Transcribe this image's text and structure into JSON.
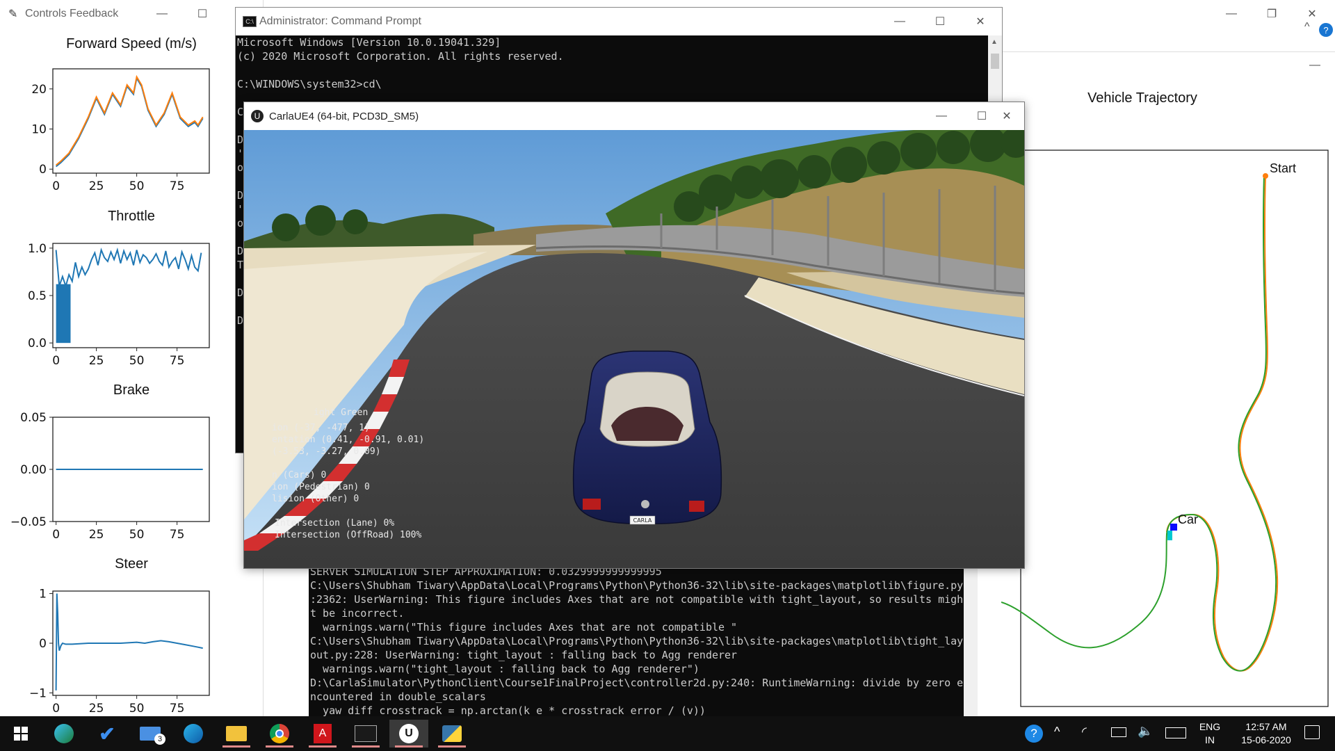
{
  "controls_window": {
    "title": "Controls Feedback",
    "plots": [
      {
        "title": "Forward Speed (m/s)",
        "yticks": [
          "0",
          "10",
          "20"
        ],
        "xticks": [
          "0",
          "25",
          "50",
          "75"
        ]
      },
      {
        "title": "Throttle",
        "yticks": [
          "0.0",
          "0.5",
          "1.0"
        ],
        "xticks": [
          "0",
          "25",
          "50",
          "75"
        ]
      },
      {
        "title": "Brake",
        "yticks": [
          "−0.05",
          "0.00",
          "0.05"
        ],
        "xticks": [
          "0",
          "25",
          "50",
          "75"
        ]
      },
      {
        "title": "Steer",
        "yticks": [
          "−1",
          "0",
          "1"
        ],
        "xticks": [
          "0",
          "25",
          "50",
          "75"
        ]
      }
    ]
  },
  "chart_data": [
    {
      "type": "line",
      "title": "Forward Speed (m/s)",
      "xlim": [
        -2,
        95
      ],
      "ylim": [
        -1,
        25
      ],
      "series": [
        {
          "color": "#ff7f0e",
          "x": [
            0,
            3,
            8,
            14,
            20,
            25,
            30,
            35,
            40,
            44,
            48,
            50,
            53,
            57,
            62,
            67,
            72,
            77,
            82,
            86,
            88,
            91
          ],
          "y": [
            1,
            2,
            4,
            8,
            13,
            18,
            14,
            19,
            16,
            21,
            19,
            23,
            21,
            15,
            11,
            14,
            19,
            13,
            11,
            12,
            11,
            13
          ]
        }
      ]
    },
    {
      "type": "line",
      "title": "Throttle",
      "xlim": [
        -2,
        95
      ],
      "ylim": [
        -0.05,
        1.05
      ],
      "series": [
        {
          "color": "#1f77b4",
          "x": [
            0,
            2,
            4,
            6,
            8,
            10,
            12,
            14,
            16,
            18,
            20,
            22,
            24,
            26,
            28,
            30,
            32,
            34,
            36,
            38,
            40,
            42,
            44,
            46,
            48,
            50,
            52,
            54,
            56,
            58,
            60,
            62,
            64,
            66,
            68,
            70,
            72,
            74,
            76,
            78,
            80,
            82,
            84,
            86,
            88,
            90
          ],
          "y": [
            0.98,
            0.6,
            0.7,
            0.6,
            0.72,
            0.65,
            0.85,
            0.7,
            0.8,
            0.72,
            0.78,
            0.88,
            0.95,
            0.82,
            0.98,
            0.9,
            0.86,
            0.96,
            0.88,
            0.98,
            0.84,
            0.97,
            0.88,
            0.95,
            0.82,
            0.98,
            0.85,
            0.93,
            0.9,
            0.84,
            0.88,
            0.94,
            0.86,
            0.82,
            0.97,
            0.8,
            0.86,
            0.9,
            0.78,
            0.96,
            0.88,
            0.78,
            0.92,
            0.8,
            0.76,
            0.95
          ]
        }
      ]
    },
    {
      "type": "line",
      "title": "Brake",
      "xlim": [
        -2,
        95
      ],
      "ylim": [
        -0.05,
        0.05
      ],
      "series": [
        {
          "color": "#1f77b4",
          "x": [
            0,
            91
          ],
          "y": [
            0,
            0
          ]
        }
      ]
    },
    {
      "type": "line",
      "title": "Steer",
      "xlim": [
        -2,
        95
      ],
      "ylim": [
        -1.05,
        1.05
      ],
      "series": [
        {
          "color": "#1f77b4",
          "x": [
            0,
            0.5,
            1,
            1.5,
            2,
            3,
            4,
            6,
            10,
            20,
            30,
            40,
            50,
            55,
            60,
            65,
            70,
            75,
            80,
            85,
            88,
            91
          ],
          "y": [
            -0.95,
            1.0,
            0.6,
            0.0,
            -0.15,
            -0.05,
            0.0,
            -0.02,
            -0.02,
            0.0,
            0.0,
            0.0,
            0.02,
            0.0,
            0.03,
            0.05,
            0.03,
            0.0,
            -0.03,
            -0.06,
            -0.08,
            -0.1
          ]
        }
      ]
    },
    {
      "type": "line",
      "title": "Vehicle Trajectory",
      "annotations": [
        "Start",
        "Car"
      ],
      "series": [
        {
          "name": "",
          "color": "#ff7f0e"
        },
        {
          "name": "",
          "color": "#2ca02c"
        }
      ]
    }
  ],
  "cmd_window": {
    "title": "Administrator: Command Prompt",
    "lines": [
      "Microsoft Windows [Version 10.0.19041.329]",
      "(c) 2020 Microsoft Corporation. All rights reserved.",
      "",
      "C:\\WINDOWS\\system32>cd\\",
      "",
      "C",
      "",
      "D",
      "'",
      "o",
      "",
      "D",
      "'",
      "o",
      "",
      "D",
      "T",
      "",
      "D",
      "",
      "D"
    ]
  },
  "terminal_bottom": {
    "lines": [
      "SERVER SIMULATION STEP APPROXIMATION: 0.0329999999999995",
      "C:\\Users\\Shubham Tiwary\\AppData\\Local\\Programs\\Python\\Python36-32\\lib\\site-packages\\matplotlib\\figure.py",
      ":2362: UserWarning: This figure includes Axes that are not compatible with tight_layout, so results migh",
      "t be incorrect.",
      "  warnings.warn(\"This figure includes Axes that are not compatible \"",
      "C:\\Users\\Shubham Tiwary\\AppData\\Local\\Programs\\Python\\Python36-32\\lib\\site-packages\\matplotlib\\tight_lay",
      "out.py:228: UserWarning: tight_layout : falling back to Agg renderer",
      "  warnings.warn(\"tight_layout : falling back to Agg renderer\")",
      "D:\\CarlaSimulator\\PythonClient\\Course1FinalProject\\controller2d.py:240: RuntimeWarning: divide by zero e",
      "ncountered in double_scalars",
      "  yaw_diff_crosstrack = np.arctan(k_e * crosstrack_error / (v))"
    ]
  },
  "trajectory_window": {
    "title": "Vehicle Trajectory",
    "start_label": "Start",
    "car_label": "Car"
  },
  "carla_window": {
    "title": "CarlaUE4 (64-bit, PCD3D_SM5)",
    "hud": [
      "ight  Green",
      "ion          (-37, -477, 1)",
      "entation     (0.41, -0.91, 0.01)",
      "             (-3.53, -3.27, 0.09)",
      "n (Cars)          0",
      "ion (Pedestrian)  0",
      "lision (Other)    0",
      "Intersection (Lane)     0%",
      "Intersection (OffRoad)  100%"
    ],
    "plate": "CARLA"
  },
  "taskbar": {
    "lang": "ENG",
    "region": "IN",
    "time": "12:57 AM",
    "date": "15-06-2020",
    "mail_badge": "3"
  }
}
